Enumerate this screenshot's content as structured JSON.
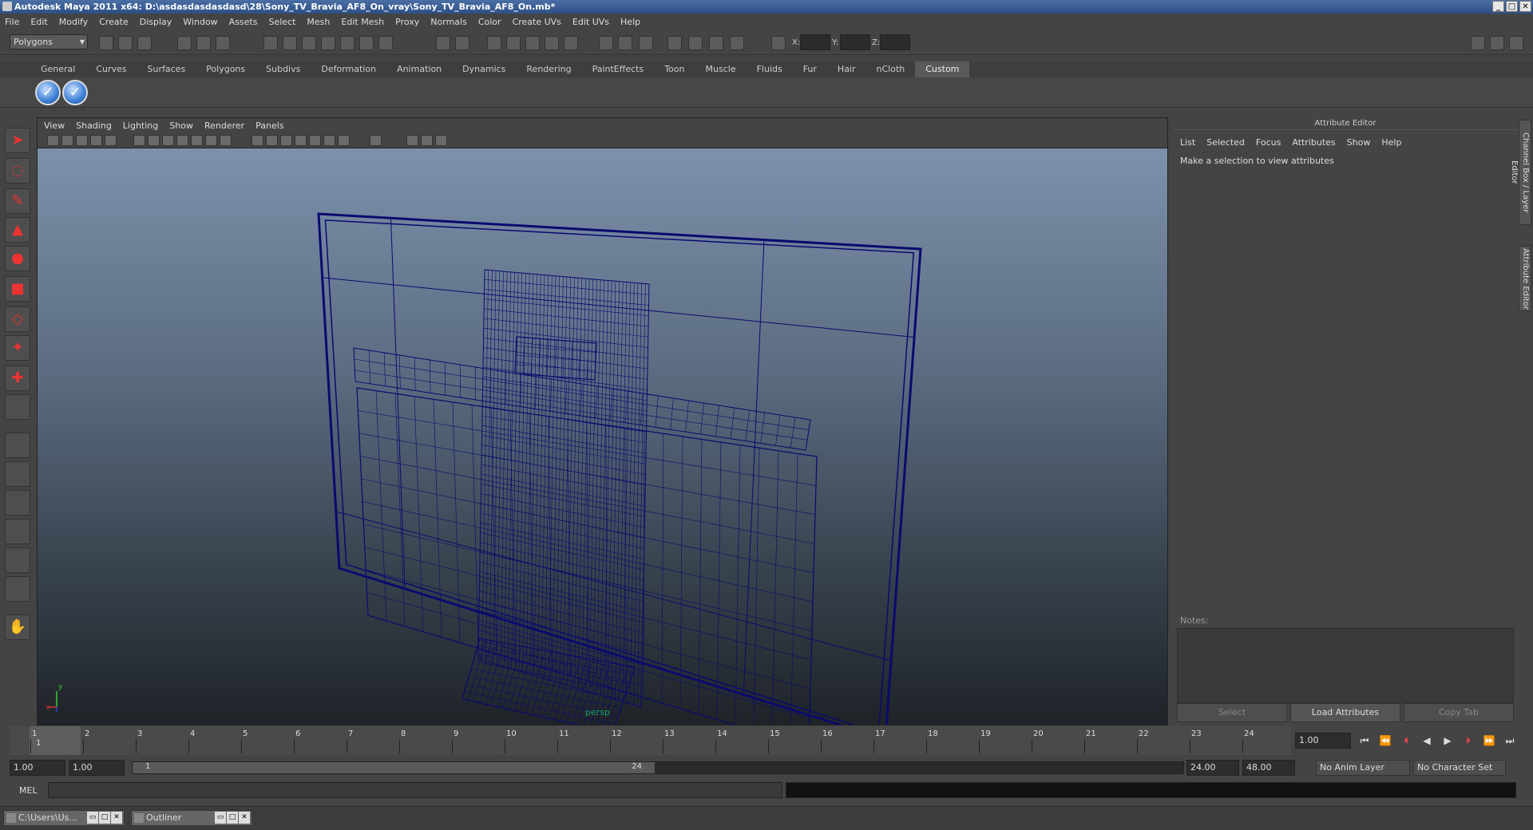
{
  "window": {
    "title": "Autodesk Maya 2011 x64: D:\\asdasdasdasdasd\\28\\Sony_TV_Bravia_AF8_On_vray\\Sony_TV_Bravia_AF8_On.mb*",
    "minimize": "_",
    "maximize": "□",
    "close": "✕"
  },
  "menubar": [
    "File",
    "Edit",
    "Modify",
    "Create",
    "Display",
    "Window",
    "Assets",
    "Select",
    "Mesh",
    "Edit Mesh",
    "Proxy",
    "Normals",
    "Color",
    "Create UVs",
    "Edit UVs",
    "Help"
  ],
  "statusline": {
    "mode": "Polygons",
    "x_label": "X:",
    "y_label": "Y:",
    "z_label": "Z:"
  },
  "shelf": {
    "tabs": [
      "General",
      "Curves",
      "Surfaces",
      "Polygons",
      "Subdivs",
      "Deformation",
      "Animation",
      "Dynamics",
      "Rendering",
      "PaintEffects",
      "Toon",
      "Muscle",
      "Fluids",
      "Fur",
      "Hair",
      "nCloth",
      "Custom"
    ],
    "active_tab": "Custom",
    "button_glyph": "✓"
  },
  "panel": {
    "menu": [
      "View",
      "Shading",
      "Lighting",
      "Show",
      "Renderer",
      "Panels"
    ],
    "camera": "persp",
    "axis_x": "x",
    "axis_y": "y"
  },
  "attribute_editor": {
    "title": "Attribute Editor",
    "menu": [
      "List",
      "Selected",
      "Focus",
      "Attributes",
      "Show",
      "Help"
    ],
    "message": "Make a selection to view attributes",
    "notes_label": "Notes:",
    "buttons": [
      "Select",
      "Load Attributes",
      "Copy Tab"
    ]
  },
  "side_tabs": [
    "Channel Box / Layer Editor",
    "Attribute Editor"
  ],
  "timeline": {
    "start": 1,
    "end": 24,
    "current_frame_label": "1",
    "current_frame": "1.00"
  },
  "range": {
    "start_time": "1.00",
    "playback_start": "1.00",
    "thumb_start": "1",
    "thumb_end": "24",
    "playback_end": "24.00",
    "end_time": "48.00",
    "anim_layer": "No Anim Layer",
    "character_set": "No Character Set"
  },
  "command_line": {
    "label": "MEL"
  },
  "taskbar": [
    {
      "label": "C:\\Users\\Us..."
    },
    {
      "label": "Outliner"
    }
  ],
  "colors": {
    "wireframe": "#0a0a6e",
    "accent_blue": "#3b7fd4"
  }
}
